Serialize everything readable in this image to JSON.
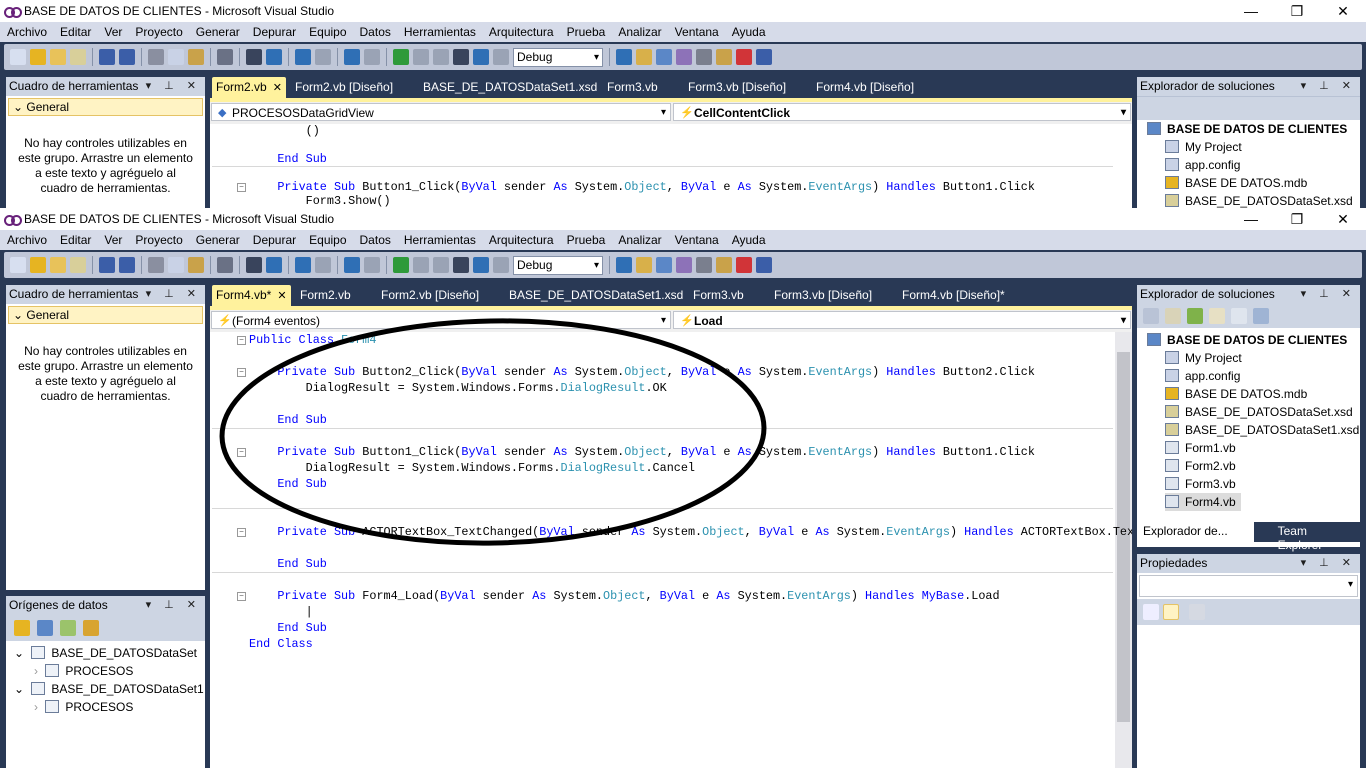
{
  "app_title": "BASE DE DATOS DE CLIENTES - Microsoft Visual Studio",
  "window_controls": {
    "minimize": "—",
    "maximize": "❐",
    "close": "✕"
  },
  "menu": [
    "Archivo",
    "Editar",
    "Ver",
    "Proyecto",
    "Generar",
    "Depurar",
    "Equipo",
    "Datos",
    "Herramientas",
    "Arquitectura",
    "Prueba",
    "Analizar",
    "Ventana",
    "Ayuda"
  ],
  "toolbar": {
    "configuration": "Debug"
  },
  "toolbox": {
    "title": "Cuadro de herramientas",
    "header_controls": "▾ ⊥ ✕",
    "group": "General",
    "empty_text": "No hay controles utilizables en este grupo. Arrastre un elemento a este texto y agréguelo al cuadro de herramientas."
  },
  "back_window": {
    "tabs": [
      "Form2.vb",
      "Form2.vb [Diseño]",
      "BASE_DE_DATOSDataSet1.xsd",
      "Form3.vb",
      "Form3.vb [Diseño]",
      "Form4.vb [Diseño]"
    ],
    "active_tab_close": "✕",
    "nav_object": "PROCESOSDataGridView",
    "nav_event": "CellContentClick",
    "code": [
      [
        [
          "        ()",
          "p"
        ]
      ],
      [
        [
          "",
          "p"
        ]
      ],
      [
        [
          "    ",
          "p"
        ],
        [
          "End Sub",
          "k"
        ]
      ],
      [
        [
          "",
          "p"
        ]
      ],
      [
        [
          "    ",
          "p"
        ],
        [
          "Private Sub ",
          "k"
        ],
        [
          "Button1_Click(",
          "p"
        ],
        [
          "ByVal",
          "k"
        ],
        [
          " sender ",
          "p"
        ],
        [
          "As",
          "k"
        ],
        [
          " System.",
          "p"
        ],
        [
          "Object",
          "t"
        ],
        [
          ", ",
          "p"
        ],
        [
          "ByVal",
          "k"
        ],
        [
          " e ",
          "p"
        ],
        [
          "As",
          "k"
        ],
        [
          " System.",
          "p"
        ],
        [
          "EventArgs",
          "t"
        ],
        [
          ") ",
          "p"
        ],
        [
          "Handles",
          "k"
        ],
        [
          " Button1.Click",
          "p"
        ]
      ],
      [
        [
          "        Form3.Show()",
          "p"
        ]
      ]
    ],
    "solution": {
      "title": "Explorador de soluciones",
      "items": [
        "BASE DE DATOS DE CLIENTES",
        "My Project",
        "app.config",
        "BASE DE DATOS.mdb",
        "BASE_DE_DATOSDataSet.xsd"
      ]
    }
  },
  "front_window": {
    "tabs": [
      "Form4.vb*",
      "Form2.vb",
      "Form2.vb [Diseño]",
      "BASE_DE_DATOSDataSet1.xsd",
      "Form3.vb",
      "Form3.vb [Diseño]",
      "Form4.vb [Diseño]*"
    ],
    "active_tab_close": "✕",
    "nav_object": "(Form4 eventos)",
    "nav_event": "Load",
    "code": [
      [
        [
          "Public Class ",
          "k"
        ],
        [
          "Form4",
          "t"
        ]
      ],
      [
        [
          "",
          "p"
        ]
      ],
      [
        [
          "    ",
          "p"
        ],
        [
          "Private Sub ",
          "k"
        ],
        [
          "Button2_Click(",
          "p"
        ],
        [
          "ByVal",
          "k"
        ],
        [
          " sender ",
          "p"
        ],
        [
          "As",
          "k"
        ],
        [
          " System.",
          "p"
        ],
        [
          "Object",
          "t"
        ],
        [
          ", ",
          "p"
        ],
        [
          "ByVal",
          "k"
        ],
        [
          " e ",
          "p"
        ],
        [
          "As",
          "k"
        ],
        [
          " System.",
          "p"
        ],
        [
          "EventArgs",
          "t"
        ],
        [
          ") ",
          "p"
        ],
        [
          "Handles",
          "k"
        ],
        [
          " Button2.Click",
          "p"
        ]
      ],
      [
        [
          "        DialogResult = System.Windows.Forms.",
          "p"
        ],
        [
          "DialogResult",
          "t"
        ],
        [
          ".OK",
          "p"
        ]
      ],
      [
        [
          "",
          "p"
        ]
      ],
      [
        [
          "    ",
          "p"
        ],
        [
          "End Sub",
          "k"
        ]
      ],
      [
        [
          "",
          "p"
        ]
      ],
      [
        [
          "    ",
          "p"
        ],
        [
          "Private Sub ",
          "k"
        ],
        [
          "Button1_Click(",
          "p"
        ],
        [
          "ByVal",
          "k"
        ],
        [
          " sender ",
          "p"
        ],
        [
          "As",
          "k"
        ],
        [
          " System.",
          "p"
        ],
        [
          "Object",
          "t"
        ],
        [
          ", ",
          "p"
        ],
        [
          "ByVal",
          "k"
        ],
        [
          " e ",
          "p"
        ],
        [
          "As",
          "k"
        ],
        [
          " System.",
          "p"
        ],
        [
          "EventArgs",
          "t"
        ],
        [
          ") ",
          "p"
        ],
        [
          "Handles",
          "k"
        ],
        [
          " Button1.Click",
          "p"
        ]
      ],
      [
        [
          "        DialogResult = System.Windows.Forms.",
          "p"
        ],
        [
          "DialogResult",
          "t"
        ],
        [
          ".Cancel",
          "p"
        ]
      ],
      [
        [
          "    ",
          "p"
        ],
        [
          "End Sub",
          "k"
        ]
      ],
      [
        [
          "",
          "p"
        ]
      ],
      [
        [
          "",
          "p"
        ]
      ],
      [
        [
          "    ",
          "p"
        ],
        [
          "Private Sub ",
          "k"
        ],
        [
          "ACTORTextBox_TextChanged(",
          "p"
        ],
        [
          "ByVal",
          "k"
        ],
        [
          " sender ",
          "p"
        ],
        [
          "As",
          "k"
        ],
        [
          " System.",
          "p"
        ],
        [
          "Object",
          "t"
        ],
        [
          ", ",
          "p"
        ],
        [
          "ByVal",
          "k"
        ],
        [
          " e ",
          "p"
        ],
        [
          "As",
          "k"
        ],
        [
          " System.",
          "p"
        ],
        [
          "EventArgs",
          "t"
        ],
        [
          ") ",
          "p"
        ],
        [
          "Handles",
          "k"
        ],
        [
          " ACTORTextBox.TextChanged",
          "p"
        ]
      ],
      [
        [
          "",
          "p"
        ]
      ],
      [
        [
          "    ",
          "p"
        ],
        [
          "End Sub",
          "k"
        ]
      ],
      [
        [
          "",
          "p"
        ]
      ],
      [
        [
          "    ",
          "p"
        ],
        [
          "Private Sub ",
          "k"
        ],
        [
          "Form4_Load(",
          "p"
        ],
        [
          "ByVal",
          "k"
        ],
        [
          " sender ",
          "p"
        ],
        [
          "As",
          "k"
        ],
        [
          " System.",
          "p"
        ],
        [
          "Object",
          "t"
        ],
        [
          ", ",
          "p"
        ],
        [
          "ByVal",
          "k"
        ],
        [
          " e ",
          "p"
        ],
        [
          "As",
          "k"
        ],
        [
          " System.",
          "p"
        ],
        [
          "EventArgs",
          "t"
        ],
        [
          ") ",
          "p"
        ],
        [
          "Handles",
          "k"
        ],
        [
          " ",
          "p"
        ],
        [
          "MyBase",
          "k"
        ],
        [
          ".Load",
          "p"
        ]
      ],
      [
        [
          "        |",
          "p"
        ]
      ],
      [
        [
          "    ",
          "p"
        ],
        [
          "End Sub",
          "k"
        ]
      ],
      [
        [
          "End Class",
          "k"
        ]
      ]
    ],
    "data_sources": {
      "title": "Orígenes de datos",
      "items": [
        {
          "name": "BASE_DE_DATOSDataSet",
          "child": "PROCESOS"
        },
        {
          "name": "BASE_DE_DATOSDataSet1",
          "child": "PROCESOS"
        }
      ]
    },
    "solution": {
      "title": "Explorador de soluciones",
      "items": [
        "BASE DE DATOS DE CLIENTES",
        "My Project",
        "app.config",
        "BASE DE DATOS.mdb",
        "BASE_DE_DATOSDataSet.xsd",
        "BASE_DE_DATOSDataSet1.xsd",
        "Form1.vb",
        "Form2.vb",
        "Form3.vb",
        "Form4.vb"
      ],
      "selected": "Form4.vb",
      "bottom_tabs": [
        "Explorador de...",
        "Team Explorer"
      ]
    },
    "properties": {
      "title": "Propiedades"
    }
  },
  "annotation": {
    "shape": "ellipse",
    "color": "#000000"
  },
  "colors": {
    "background": "#293955",
    "active_tab": "#fff29d",
    "keyword": "#0000ff",
    "type": "#2b91af"
  }
}
